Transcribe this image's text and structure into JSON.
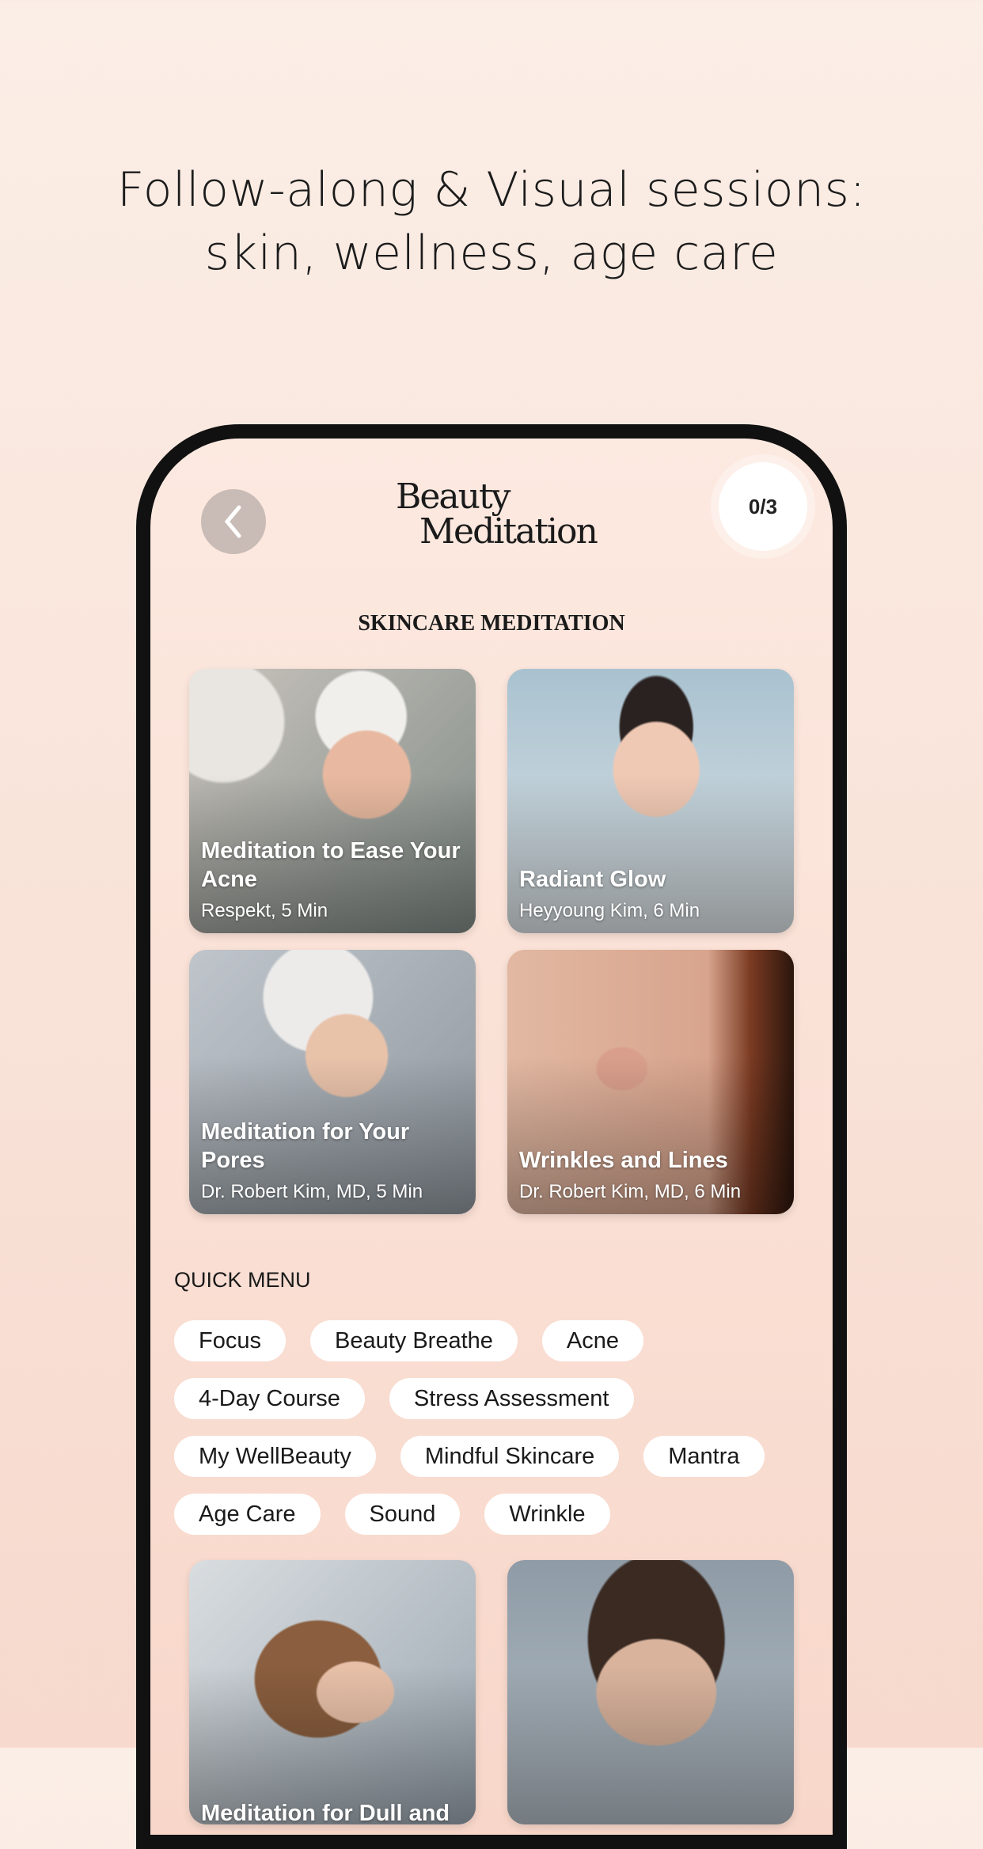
{
  "headline": {
    "line1": "Follow-along & Visual sessions:",
    "line2": "skin, wellness, age care"
  },
  "app": {
    "logo_line1": "Beauty",
    "logo_line2": "Meditation",
    "counter": "0/3",
    "section_title": "SKINCARE MEDITATION"
  },
  "cards": [
    {
      "title": "Meditation to Ease Your Acne",
      "subtitle": "Respekt, 5 Min"
    },
    {
      "title": "Radiant Glow",
      "subtitle": "Heyyoung Kim, 6 Min"
    },
    {
      "title": "Meditation for Your Pores",
      "subtitle": "Dr. Robert Kim, MD, 5 Min"
    },
    {
      "title": "Wrinkles and Lines",
      "subtitle": "Dr. Robert Kim, MD, 6 Min"
    },
    {
      "title": "Meditation for Dull and",
      "subtitle": ""
    },
    {
      "title": "",
      "subtitle": ""
    }
  ],
  "quick_menu": {
    "label": "QUICK MENU",
    "rows": [
      [
        "Focus",
        "Beauty Breathe",
        "Acne"
      ],
      [
        "4-Day Course",
        "Stress Assessment"
      ],
      [
        "My WellBeauty",
        "Mindful Skincare",
        "Mantra"
      ],
      [
        "Age Care",
        "Sound",
        "Wrinkle"
      ]
    ]
  }
}
